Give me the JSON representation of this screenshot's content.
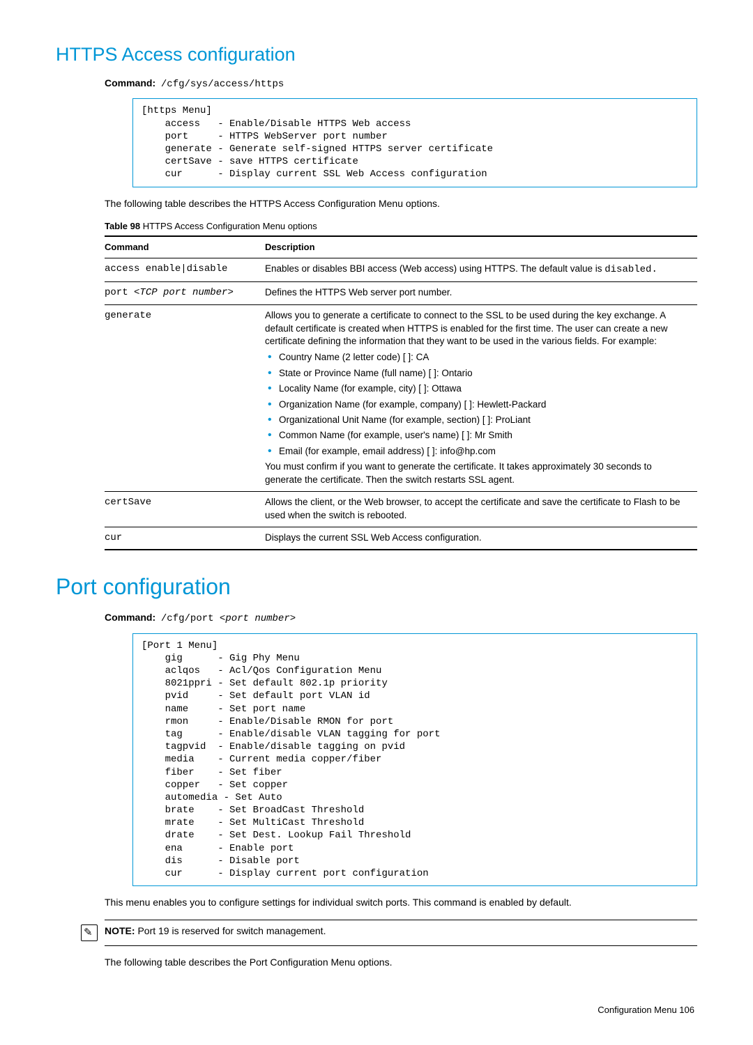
{
  "https_section": {
    "title": "HTTPS Access configuration",
    "command_label": "Command:",
    "command_value": "/cfg/sys/access/https",
    "menu_text": "[https Menu]\n    access   - Enable/Disable HTTPS Web access\n    port     - HTTPS WebServer port number\n    generate - Generate self-signed HTTPS server certificate\n    certSave - save HTTPS certificate\n    cur      - Display current SSL Web Access configuration",
    "intro_text": "The following table describes the HTTPS Access Configuration Menu options.",
    "table_label": "Table 98",
    "table_caption": "HTTPS Access Configuration Menu options",
    "headers": {
      "cmd": "Command",
      "desc": "Description"
    },
    "rows": {
      "r0": {
        "cmd": "access enable|disable",
        "desc_a": "Enables or disables BBI access (Web access) using HTTPS. The default value is ",
        "desc_b": "disabled."
      },
      "r1": {
        "cmd_a": "port ",
        "cmd_b": "<TCP port number>",
        "desc": "Defines the HTTPS Web server port number."
      },
      "r2": {
        "cmd": "generate",
        "desc_intro": "Allows you to generate a certificate to connect to the SSL to be used during the key exchange. A default certificate is created when HTTPS is enabled for the first time. The user can create a new certificate defining the information that they want to be used in the various fields. For example:",
        "bullets": {
          "b0": "Country Name (2 letter code) [  ]:  CA",
          "b1": "State or Province Name (full name) [  ]:  Ontario",
          "b2": "Locality Name (for example, city) [  ]:  Ottawa",
          "b3": "Organization Name (for example, company) [  ]:  Hewlett-Packard",
          "b4": "Organizational Unit Name (for example, section) [  ]:  ProLiant",
          "b5": "Common Name (for example, user's name) [  ]:  Mr Smith",
          "b6": "Email (for example, email address) [  ]:  info@hp.com"
        },
        "desc_outro": "You must confirm if you want to generate the certificate. It takes approximately 30 seconds to generate the certificate. Then the switch restarts SSL agent."
      },
      "r3": {
        "cmd": "certSave",
        "desc": "Allows the client, or the Web browser, to accept the certificate and save the certificate to Flash to be used when the switch is rebooted."
      },
      "r4": {
        "cmd": "cur",
        "desc": "Displays the current SSL Web Access configuration."
      }
    }
  },
  "port_section": {
    "title": "Port configuration",
    "command_label": "Command:",
    "command_value_a": "/cfg/port ",
    "command_value_b": "<port number>",
    "menu_text": "[Port 1 Menu]\n    gig      - Gig Phy Menu\n    aclqos   - Acl/Qos Configuration Menu\n    8021ppri - Set default 802.1p priority\n    pvid     - Set default port VLAN id\n    name     - Set port name\n    rmon     - Enable/Disable RMON for port\n    tag      - Enable/disable VLAN tagging for port\n    tagpvid  - Enable/disable tagging on pvid\n    media    - Current media copper/fiber\n    fiber    - Set fiber\n    copper   - Set copper\n    automedia - Set Auto\n    brate    - Set BroadCast Threshold\n    mrate    - Set MultiCast Threshold\n    drate    - Set Dest. Lookup Fail Threshold\n    ena      - Enable port\n    dis      - Disable port\n    cur      - Display current port configuration",
    "intro_text": "This menu enables you to configure settings for individual switch ports. This command is enabled by default.",
    "note_label": "NOTE:",
    "note_text": "Port 19 is reserved for switch management.",
    "outro_text": "The following table describes the Port Configuration Menu options."
  },
  "footer": {
    "text": "Configuration Menu   106"
  }
}
